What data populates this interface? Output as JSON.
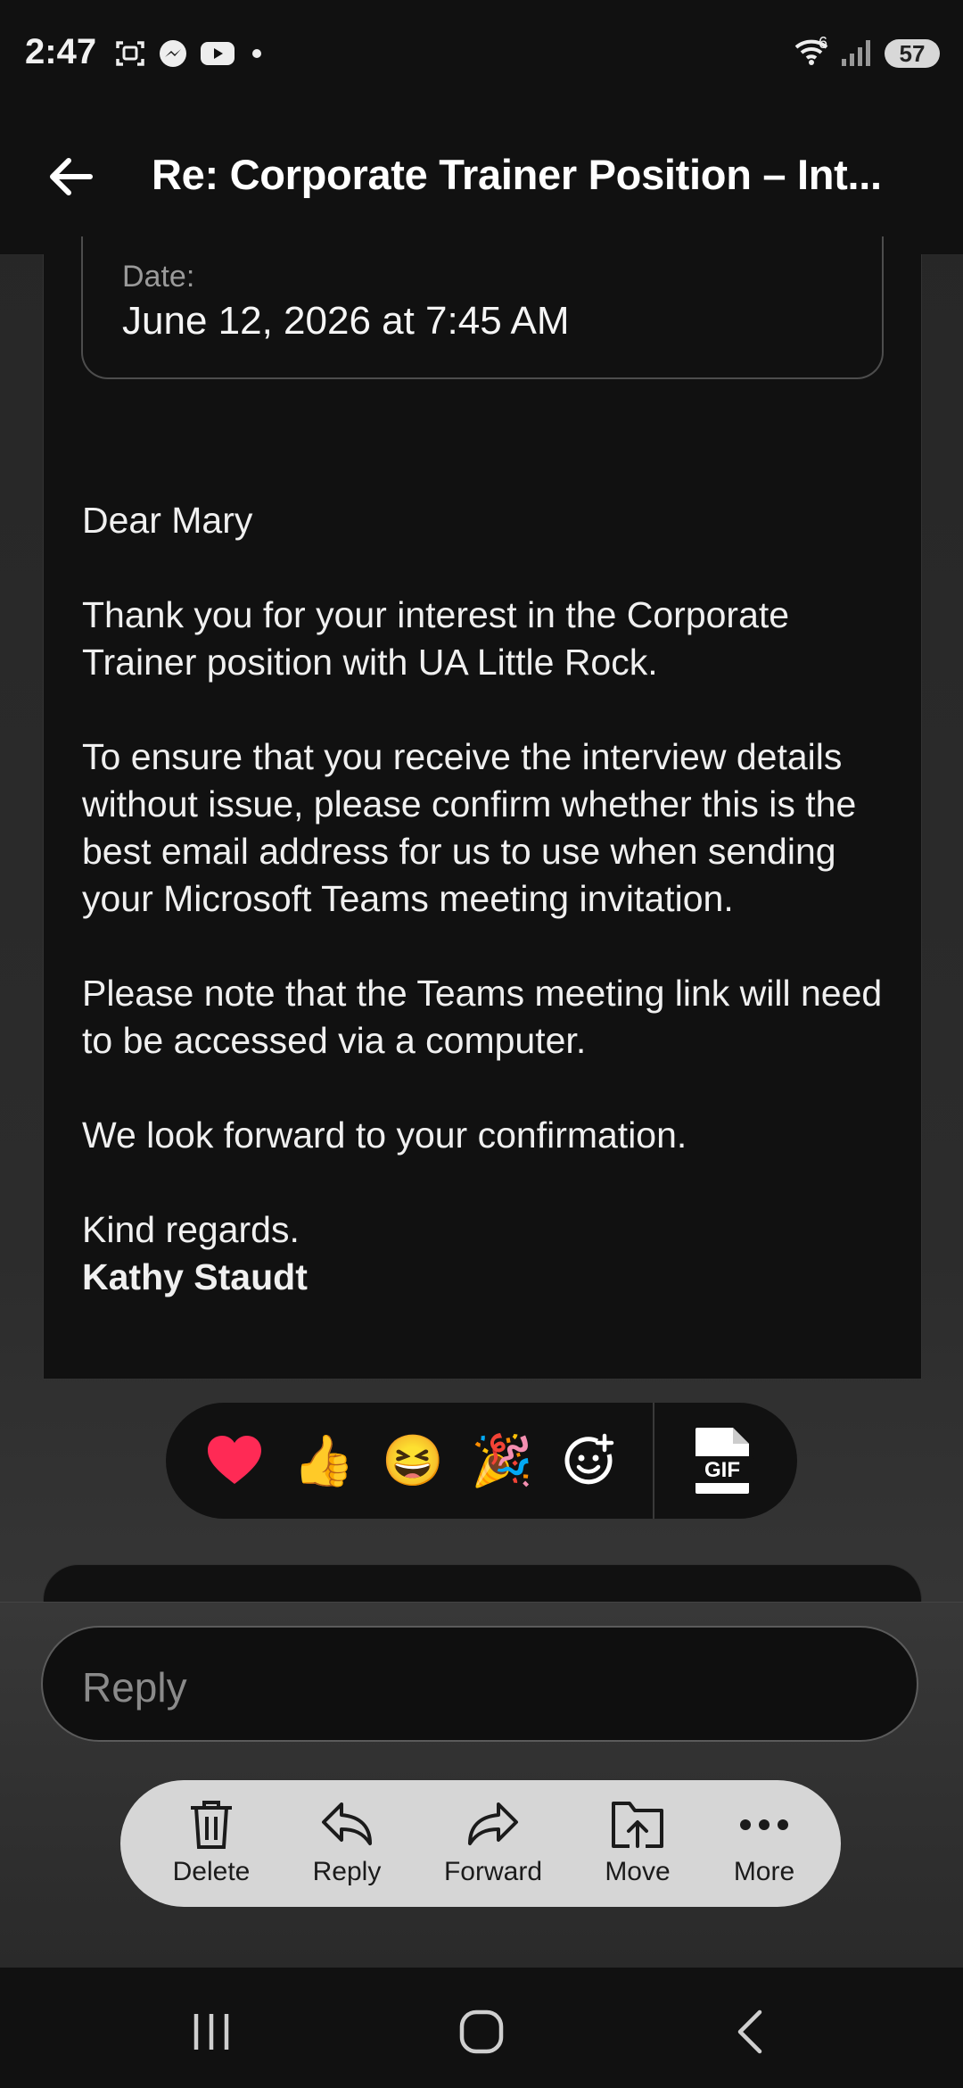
{
  "status_bar": {
    "time": "2:47",
    "wifi_badge": "6",
    "battery": "57"
  },
  "header": {
    "title": "Re: Corporate Trainer Position – Int..."
  },
  "message": {
    "date_label": "Date:",
    "date_value": "June 12, 2026 at 7:45 AM",
    "greeting": "Dear Mary",
    "paragraph_1": "Thank you for your interest in the Corporate Trainer position with UA Little Rock.",
    "paragraph_2": "To ensure that you receive the interview details without issue, please confirm whether this is the best email address for us to use when sending your Microsoft Teams meeting invitation.",
    "paragraph_3": "Please note that the Teams meeting link will need to be accessed via a computer.",
    "paragraph_4": "We look forward to your confirmation.",
    "signoff": "Kind regards.",
    "signature": "Kathy Staudt"
  },
  "reactions": {
    "heart": "❤️",
    "thumbs_up": "👍",
    "laughing": "😆",
    "party": "🎉",
    "gif_label": "GIF"
  },
  "reply": {
    "placeholder": "Reply"
  },
  "actions": {
    "delete": "Delete",
    "reply": "Reply",
    "forward": "Forward",
    "move": "Move",
    "more": "More"
  },
  "icons": {
    "back": "arrow-left-icon",
    "add_reaction": "emoji-add-icon",
    "gif": "gif-file-icon",
    "delete": "trash-icon",
    "reply": "reply-arrow-icon",
    "forward": "forward-arrow-icon",
    "move": "folder-move-icon",
    "more": "ellipsis-icon"
  }
}
